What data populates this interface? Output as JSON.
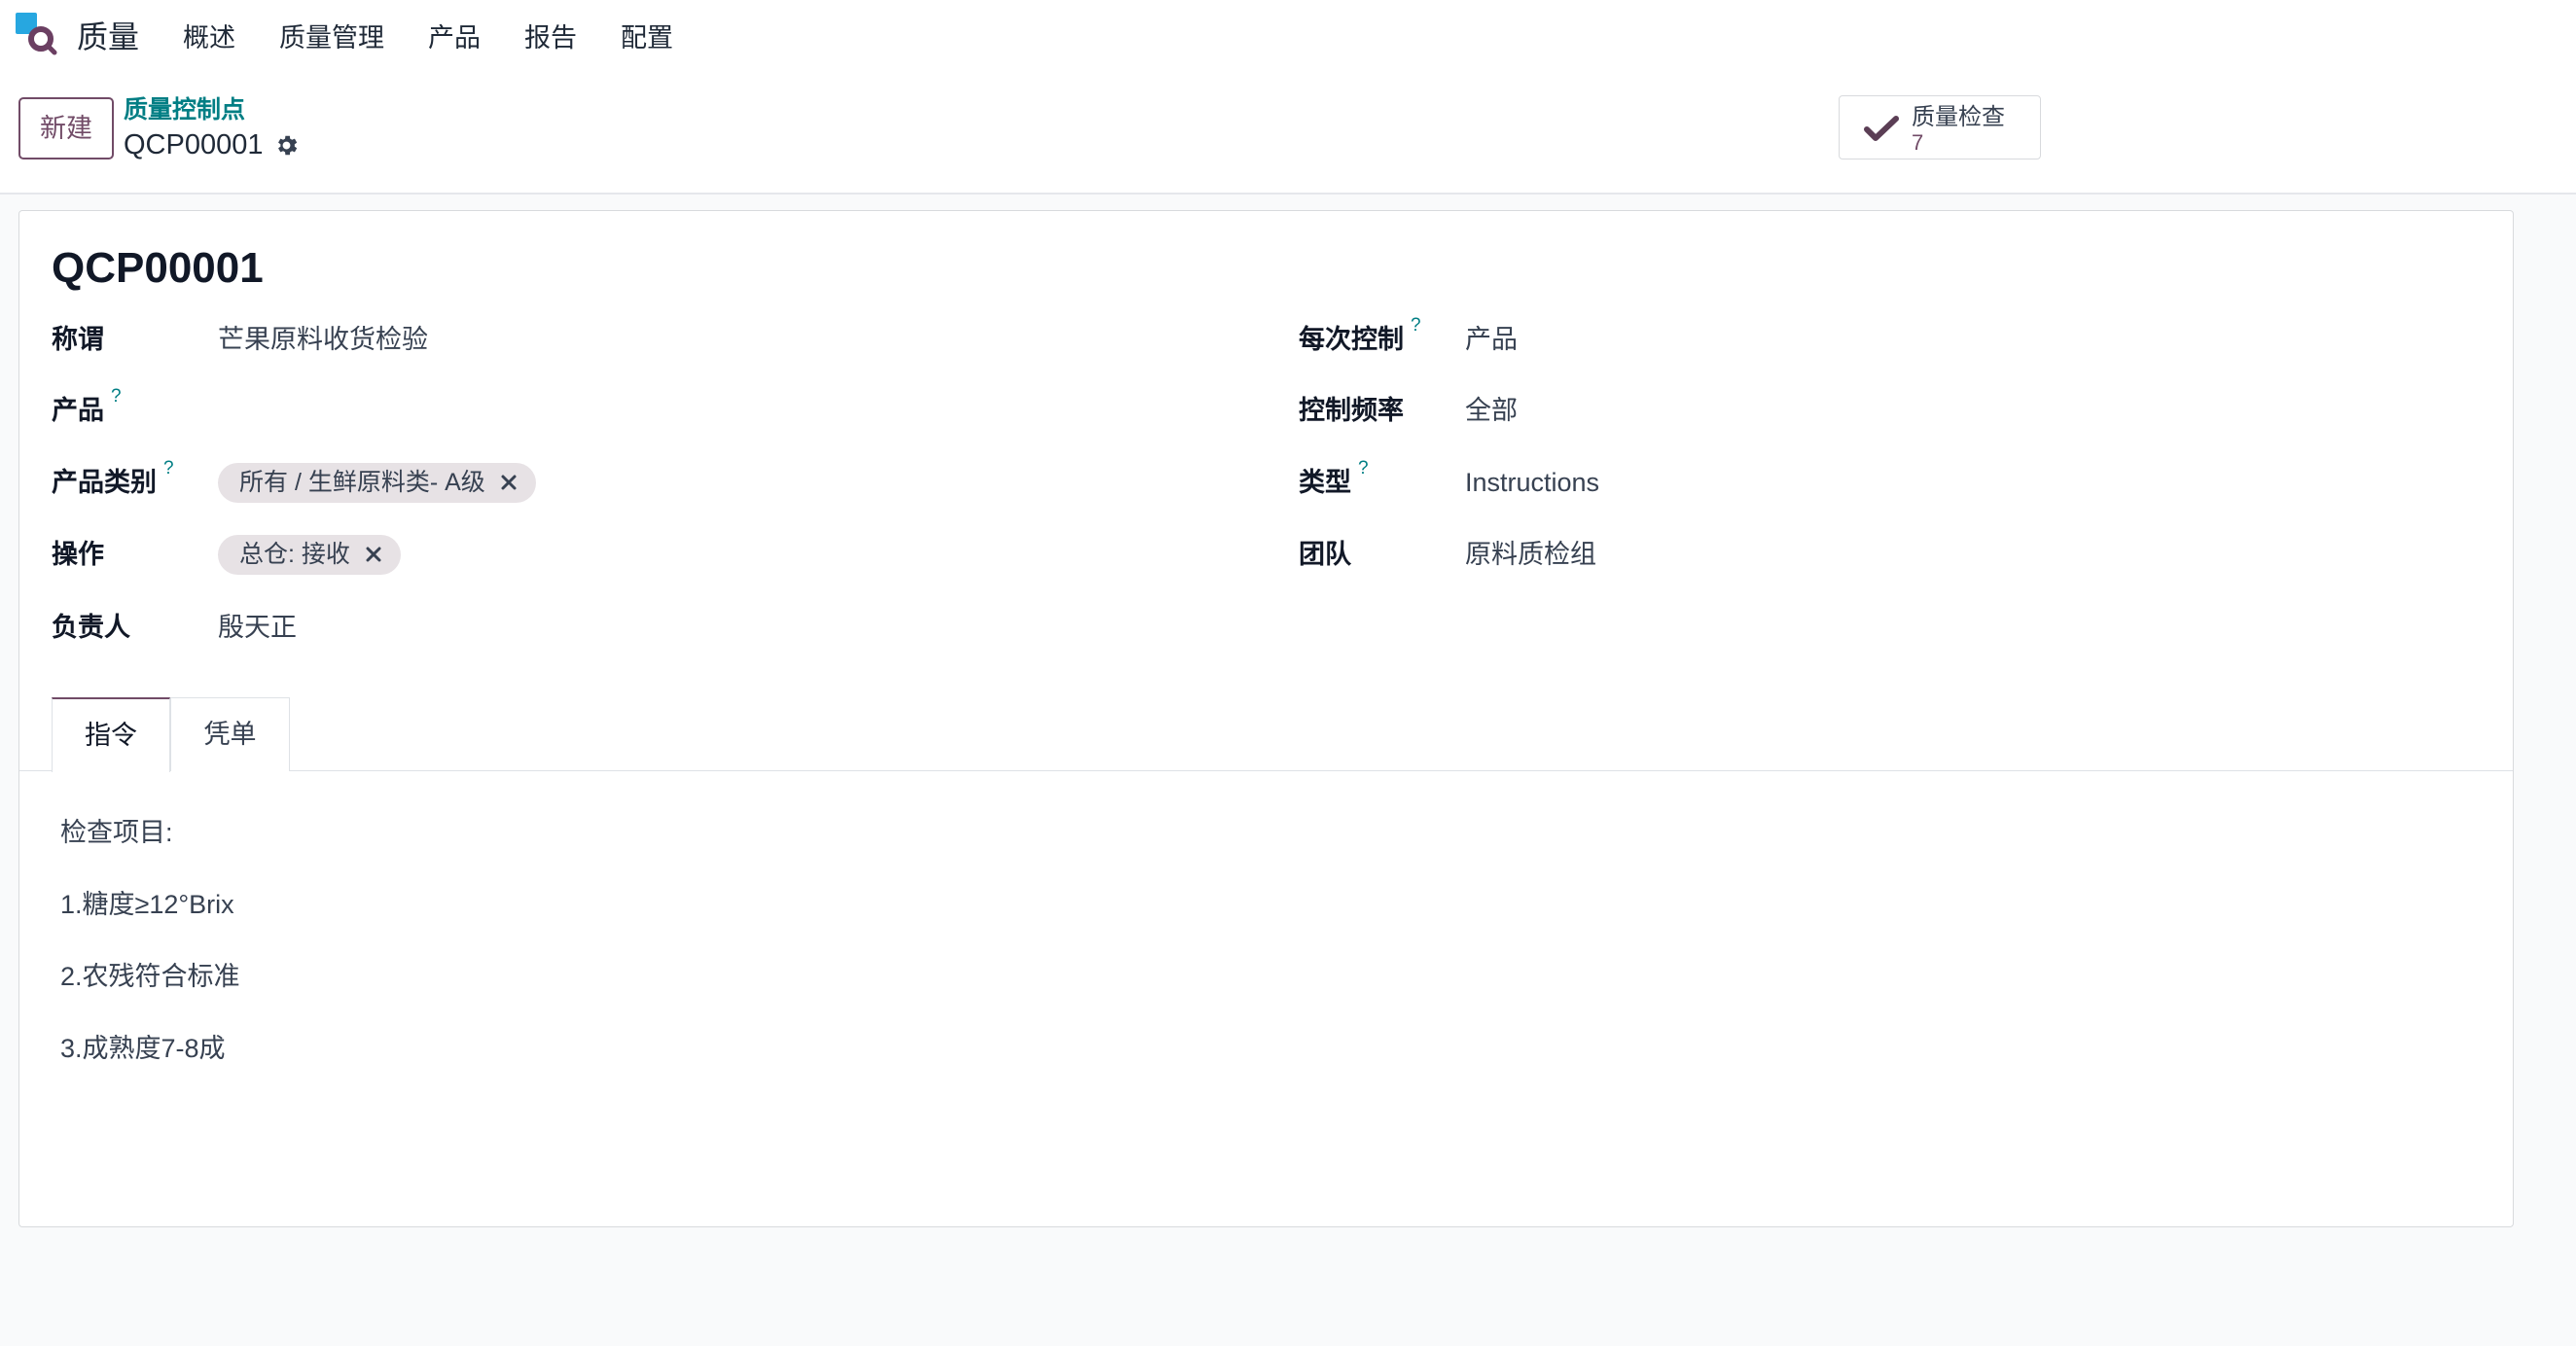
{
  "navbar": {
    "app_name": "质量",
    "app_icon": "quality-app-icon",
    "menu": [
      {
        "label": "概述"
      },
      {
        "label": "质量管理"
      },
      {
        "label": "产品"
      },
      {
        "label": "报告"
      },
      {
        "label": "配置"
      }
    ]
  },
  "control_panel": {
    "new_button": "新建",
    "breadcrumb": {
      "parent": "质量控制点",
      "current": "QCP00001"
    },
    "settings_icon": "gear-icon"
  },
  "smart_buttons": [
    {
      "icon": "check-icon",
      "label": "质量检查",
      "value": "7"
    }
  ],
  "form": {
    "title": "QCP00001",
    "left": [
      {
        "label": "称谓",
        "value": "芒果原料收货检验"
      },
      {
        "label": "产品",
        "help": "?"
      },
      {
        "label": "产品类别",
        "help": "?",
        "tags": [
          "所有 / 生鲜原料类- A级"
        ]
      },
      {
        "label": "操作",
        "tags": [
          "总仓: 接收"
        ]
      },
      {
        "label": "负责人",
        "value": "殷天正"
      }
    ],
    "right": [
      {
        "label": "每次控制",
        "help": "?",
        "value": "产品"
      },
      {
        "label": "控制频率",
        "value": "全部"
      },
      {
        "label": "类型",
        "help": "?",
        "value": "Instructions"
      },
      {
        "label": "团队",
        "value": "原料质检组"
      }
    ],
    "tabs": [
      {
        "label": "指令",
        "active": true
      },
      {
        "label": "凭单",
        "active": false
      }
    ],
    "instructions": [
      "检查项目:",
      "1.糖度≥12°Brix",
      "2.农残符合标准",
      "3.成熟度7-8成"
    ]
  },
  "icons": {
    "tag_remove": "close-icon"
  },
  "colors": {
    "brand": "#714B67",
    "link": "#017E84",
    "tag_bg": "#E7E2E5"
  }
}
